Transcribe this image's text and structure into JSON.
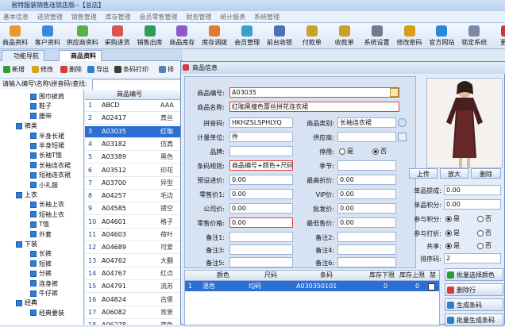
{
  "app": {
    "title": "易特服装销售连锁店版--【总店】"
  },
  "menu": [
    "基本信息",
    "进货管理",
    "销售管理",
    "库存管理",
    "会员零售管理",
    "财务管理",
    "统计报表",
    "系统管理"
  ],
  "toolbar": [
    "商品资料",
    "客户资料",
    "供应商资料",
    "采购进货",
    "销售出库",
    "商品库存",
    "库存调拨",
    "会员管理",
    "前台收银",
    "付款单",
    "收款单",
    "系统设置",
    "修改密码",
    "官方网站",
    "锁定系统",
    "更换"
  ],
  "tabs": [
    "功能导航",
    "商品资料"
  ],
  "actions": {
    "new": "新增",
    "edit": "修改",
    "delete": "删除",
    "export": "导出",
    "barcode_print": "条码打印",
    "more": "排"
  },
  "search": {
    "label": "请输入编号\\名称\\拼音码\\查找:",
    "value": ""
  },
  "tree": [
    {
      "label": "围巾披肩",
      "level": 2
    },
    {
      "label": "鞋子",
      "level": 2
    },
    {
      "label": "腰带",
      "level": 2
    },
    {
      "label": "裤类",
      "level": 1
    },
    {
      "label": "半身长裙",
      "level": 2
    },
    {
      "label": "半身短裙",
      "level": 2
    },
    {
      "label": "长袖T恤",
      "level": 2
    },
    {
      "label": "长袖连衣裙",
      "level": 2
    },
    {
      "label": "短袖连衣裙",
      "level": 2
    },
    {
      "label": "小礼服",
      "level": 2
    },
    {
      "label": "上衣",
      "level": 1
    },
    {
      "label": "长袖上衣",
      "level": 2
    },
    {
      "label": "短袖上衣",
      "level": 2
    },
    {
      "label": "T恤",
      "level": 2
    },
    {
      "label": "外套",
      "level": 2
    },
    {
      "label": "下装",
      "level": 1
    },
    {
      "label": "长裤",
      "level": 2
    },
    {
      "label": "短裤",
      "level": 2
    },
    {
      "label": "分裤",
      "level": 2
    },
    {
      "label": "连身裤",
      "level": 2
    },
    {
      "label": "牛仔裤",
      "level": 2
    },
    {
      "label": "经典",
      "level": 1
    },
    {
      "label": "经典要装",
      "level": 2
    }
  ],
  "grid": {
    "header": "商品编号",
    "rows": [
      {
        "n": "1",
        "code": "ABCD",
        "tail": "AAA"
      },
      {
        "n": "2",
        "code": "A02417",
        "tail": "真丝"
      },
      {
        "n": "3",
        "code": "A03035",
        "tail": "红咖"
      },
      {
        "n": "4",
        "code": "A03182",
        "tail": "仿真"
      },
      {
        "n": "5",
        "code": "A03389",
        "tail": "黑色"
      },
      {
        "n": "6",
        "code": "A03512",
        "tail": "印花"
      },
      {
        "n": "7",
        "code": "A03700",
        "tail": "异型"
      },
      {
        "n": "8",
        "code": "A04257",
        "tail": "毛边"
      },
      {
        "n": "9",
        "code": "A04585",
        "tail": "镂空"
      },
      {
        "n": "10",
        "code": "A04601",
        "tail": "格子"
      },
      {
        "n": "11",
        "code": "A04603",
        "tail": "荷叶"
      },
      {
        "n": "12",
        "code": "A04689",
        "tail": "可爱"
      },
      {
        "n": "13",
        "code": "A04762",
        "tail": "大翻"
      },
      {
        "n": "14",
        "code": "A04767",
        "tail": "红点"
      },
      {
        "n": "15",
        "code": "A04791",
        "tail": "流苏"
      },
      {
        "n": "16",
        "code": "A04824",
        "tail": "古堡"
      },
      {
        "n": "17",
        "code": "A06082",
        "tail": "背景"
      },
      {
        "n": "18",
        "code": "A06278",
        "tail": "夜色"
      }
    ],
    "selected_index": 2
  },
  "dialog": {
    "title": "商品信息",
    "labels": {
      "code": "商品编号:",
      "name": "商品名称:",
      "pinyin": "拼音码:",
      "unit": "计量单位:",
      "brand": "品牌:",
      "rule": "条码规则:",
      "preset_in": "预设进价:",
      "retail": "零售价1:",
      "corp": "公司价:",
      "retail2": "零售价格:",
      "note1": "备注1:",
      "note2": "备注3:",
      "note5": "备注5:",
      "category": "商品类别:",
      "supplier": "供应商:",
      "disabled": "停用:",
      "season": "季节:",
      "min_price": "最高折价:",
      "vip": "VIP价:",
      "wholesale": "批发价:",
      "lowest": "最低售价:",
      "note2r": "备注2:",
      "note4": "备注4:",
      "note6": "备注6:",
      "points_rate": "单品提成:",
      "points": "单品积分:",
      "join_points": "参与积分:",
      "join_discount": "参与打折:",
      "share": "共享:",
      "sort": "排序码:"
    },
    "values": {
      "code": "A03035",
      "name": "红咖黑撞色蕾丝拼花连衣裙",
      "pinyin": "HKHZSLSPHLYQ",
      "unit": "件",
      "brand": "",
      "rule": "商品编号+颜色+尺码",
      "preset_in": "0.00",
      "retail": "0.00",
      "corp": "0.00",
      "retail2": "0.00",
      "category": "长袖连衣裙",
      "supplier": "",
      "season": "",
      "min_price": "0.00",
      "vip": "0.00",
      "wholesale": "0.00",
      "lowest": "0.00",
      "points_rate": "0.00",
      "points": "0.00",
      "sort": "2"
    },
    "radios": {
      "yes": "是",
      "no": "否"
    },
    "photo_buttons": {
      "upload": "上传",
      "zoom": "放大",
      "delete": "删除"
    },
    "bottom_header": [
      "颜色",
      "尺码",
      "条码",
      "库存下限",
      "库存上限",
      "禁"
    ],
    "bottom_row": {
      "color": "混色",
      "size": "均码",
      "barcode": "A030350101",
      "low": "0",
      "high": "0"
    },
    "bottom_buttons": [
      "批量选择颜色",
      "删除行",
      "生成条码",
      "批量生成条码"
    ]
  }
}
